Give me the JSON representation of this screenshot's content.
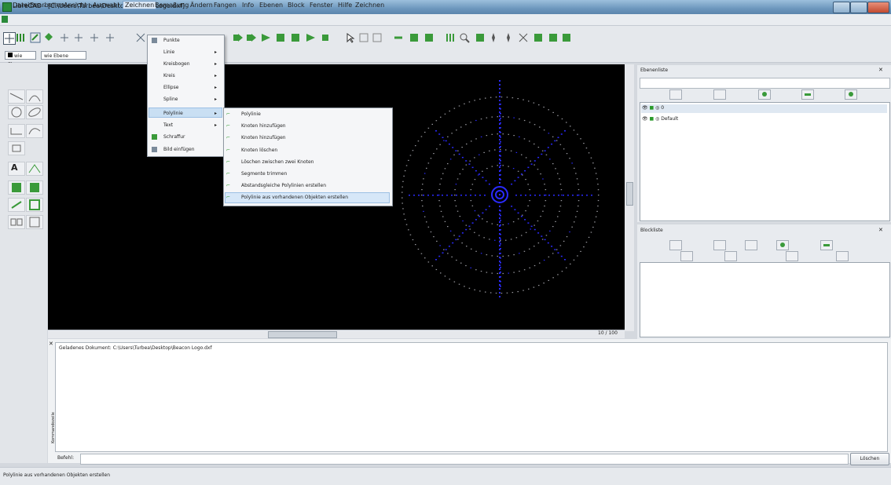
{
  "window": {
    "title": "LibreCAD - [C:\\Users\\Turbea\\Desktop\\Beacon Logo.dxf]"
  },
  "menubar": [
    "Datei",
    "Bearbeiten",
    "Ansicht",
    "Auswahl",
    "Zeichnen",
    "Bemaßung",
    "Ändern",
    "Fangen",
    "Info",
    "Ebenen",
    "Block",
    "Fenster",
    "Hilfe",
    "Zeichnen"
  ],
  "layer_combos": {
    "color": "wie Ebene",
    "linetype": "wie Ebene"
  },
  "zeichnen_menu": {
    "items": [
      {
        "label": "Punkte",
        "submenu": false
      },
      {
        "label": "Linie",
        "submenu": true
      },
      {
        "label": "Kreisbogen",
        "submenu": true
      },
      {
        "label": "Kreis",
        "submenu": true
      },
      {
        "label": "Ellipse",
        "submenu": true
      },
      {
        "label": "Spline",
        "submenu": true
      },
      {
        "label": "Polylinie",
        "submenu": true
      },
      {
        "label": "Text",
        "submenu": true
      },
      {
        "label": "Schraffur",
        "submenu": false
      },
      {
        "label": "Bild einfügen",
        "submenu": false
      }
    ]
  },
  "polylinie_submenu": {
    "items": [
      "Polylinie",
      "Knoten hinzufügen",
      "Knoten hinzufügen",
      "Knoten löschen",
      "Löschen zwischen zwei Knoten",
      "Segmente trimmen",
      "Abstandsgleiche Polylinien erstellen",
      "Polylinie aus vorhandenen Objekten erstellen"
    ]
  },
  "canvas": {
    "zoom_label": "10 / 100",
    "drawing_color_primary": "#2a2aff",
    "drawing_color_dots": "#9a9aa0"
  },
  "ebenen_panel": {
    "title": "Ebenenliste",
    "layers": [
      {
        "name": "0"
      },
      {
        "name": "Default"
      }
    ]
  },
  "block_panel": {
    "title": "Blockliste"
  },
  "command": {
    "side_label": "Kommandozeile",
    "log": "Geladenes Dokument: C:\\Users\\Turbea\\Desktop\\Beacon Logo.dxf",
    "prompt_label": "Befehl:",
    "clear_button": "Löschen"
  },
  "status": {
    "text": "Polylinie aus vorhandenen Objekten erstellen"
  }
}
